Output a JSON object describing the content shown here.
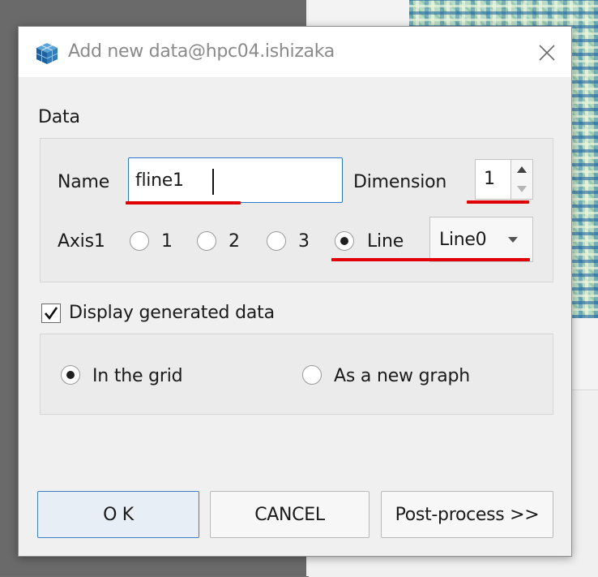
{
  "dialog": {
    "title": "Add new data@hpc04.ishizaka",
    "data_section": {
      "label": "Data",
      "name_label": "Name",
      "name_value": "fline1",
      "dimension_label": "Dimension",
      "dimension_value": "1",
      "axis_label": "Axis1",
      "axis_options": [
        "1",
        "2",
        "3",
        "Line"
      ],
      "axis_selected": "Line",
      "line_select_value": "Line0"
    },
    "display": {
      "checkbox_label": "Display generated data",
      "checked": true,
      "options": [
        "In the grid",
        "As a new graph"
      ],
      "selected": "In the grid"
    },
    "buttons": {
      "ok": "O K",
      "cancel": "CANCEL",
      "postprocess": "Post-process >>"
    }
  },
  "colors": {
    "annotation_underline": "#e00000",
    "focus_border": "#2a79c6"
  }
}
